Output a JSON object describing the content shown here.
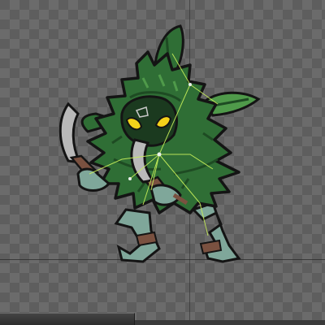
{
  "viewport": {
    "background": "transparency-checkerboard",
    "checker_colors": [
      "#5e5e5e",
      "#6b6b6b"
    ],
    "guide_color": "#2a2a2a"
  },
  "sprite": {
    "subject": "leafy-bush-creature-with-two-machetes",
    "colors": {
      "foliage": "#2f6e35",
      "foliage_dark": "#1e4b23",
      "foliage_light": "#4f9a4a",
      "outline": "#141414",
      "eyes": "#f5d21a",
      "mask": "#1b3a1f",
      "skin": "#7fa79a",
      "leather": "#7a5140",
      "blade": "#b9b9b9",
      "bone_lines": "#c8f05a"
    }
  },
  "panels": {
    "bottom_bar": "collapsed-panel"
  }
}
